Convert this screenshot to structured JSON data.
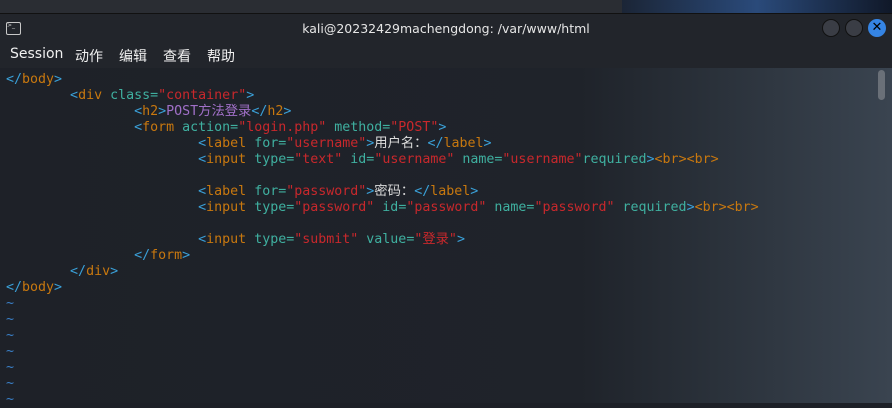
{
  "window": {
    "title": "kali@20232429machengdong: /var/www/html",
    "close_glyph": "✕"
  },
  "menu": [
    "Session",
    "动作",
    "编辑",
    "查看",
    "帮助"
  ],
  "code_lines": [
    [
      [
        "b",
        "</"
      ],
      [
        "t",
        "body"
      ],
      [
        "b",
        ">"
      ]
    ],
    [
      [
        "x",
        "        "
      ],
      [
        "b",
        "<"
      ],
      [
        "t",
        "div"
      ],
      [
        "a",
        " class="
      ],
      [
        "s",
        "\"container\""
      ],
      [
        "b",
        ">"
      ]
    ],
    [
      [
        "x",
        "                "
      ],
      [
        "b",
        "<"
      ],
      [
        "t",
        "h2"
      ],
      [
        "b",
        ">"
      ],
      [
        "p",
        "POST方法登录"
      ],
      [
        "b",
        "</"
      ],
      [
        "t",
        "h2"
      ],
      [
        "b",
        ">"
      ]
    ],
    [
      [
        "x",
        "                "
      ],
      [
        "b",
        "<"
      ],
      [
        "t",
        "form"
      ],
      [
        "a",
        " action="
      ],
      [
        "s",
        "\"login.php\""
      ],
      [
        "a",
        " method="
      ],
      [
        "s",
        "\"POST\""
      ],
      [
        "b",
        ">"
      ]
    ],
    [
      [
        "x",
        "                        "
      ],
      [
        "b",
        "<"
      ],
      [
        "t",
        "label"
      ],
      [
        "a",
        " for="
      ],
      [
        "s",
        "\"username\""
      ],
      [
        "b",
        ">"
      ],
      [
        "x",
        "用户名："
      ],
      [
        "b",
        "</"
      ],
      [
        "t",
        "label"
      ],
      [
        "b",
        ">"
      ]
    ],
    [
      [
        "x",
        "                        "
      ],
      [
        "b",
        "<"
      ],
      [
        "t",
        "input"
      ],
      [
        "a",
        " type="
      ],
      [
        "s",
        "\"text\""
      ],
      [
        "a",
        " id="
      ],
      [
        "s",
        "\"username\""
      ],
      [
        "a",
        " name="
      ],
      [
        "s",
        "\"username\""
      ],
      [
        "a",
        "required"
      ],
      [
        "b",
        ">"
      ],
      [
        "t",
        "<br>"
      ],
      [
        "t",
        "<br>"
      ]
    ],
    [],
    [
      [
        "x",
        "                        "
      ],
      [
        "b",
        "<"
      ],
      [
        "t",
        "label"
      ],
      [
        "a",
        " for="
      ],
      [
        "s",
        "\"password\""
      ],
      [
        "b",
        ">"
      ],
      [
        "x",
        "密码："
      ],
      [
        "b",
        "</"
      ],
      [
        "t",
        "label"
      ],
      [
        "b",
        ">"
      ]
    ],
    [
      [
        "x",
        "                        "
      ],
      [
        "b",
        "<"
      ],
      [
        "t",
        "input"
      ],
      [
        "a",
        " type="
      ],
      [
        "s",
        "\"password\""
      ],
      [
        "a",
        " id="
      ],
      [
        "s",
        "\"password\""
      ],
      [
        "a",
        " name="
      ],
      [
        "s",
        "\"password\""
      ],
      [
        "a",
        " required"
      ],
      [
        "b",
        ">"
      ],
      [
        "t",
        "<br>"
      ],
      [
        "t",
        "<br>"
      ]
    ],
    [],
    [
      [
        "x",
        "                        "
      ],
      [
        "b",
        "<"
      ],
      [
        "t",
        "input"
      ],
      [
        "a",
        " type="
      ],
      [
        "s",
        "\"submit\""
      ],
      [
        "a",
        " value="
      ],
      [
        "s",
        "\"登录\""
      ],
      [
        "b",
        ">"
      ]
    ],
    [
      [
        "x",
        "                "
      ],
      [
        "b",
        "</"
      ],
      [
        "t",
        "form"
      ],
      [
        "b",
        ">"
      ]
    ],
    [
      [
        "x",
        "        "
      ],
      [
        "b",
        "</"
      ],
      [
        "t",
        "div"
      ],
      [
        "b",
        ">"
      ]
    ],
    [
      [
        "b",
        "</"
      ],
      [
        "t",
        "body"
      ],
      [
        "b",
        ">"
      ]
    ]
  ],
  "empty_line_marker": "~",
  "empty_line_count": 7
}
